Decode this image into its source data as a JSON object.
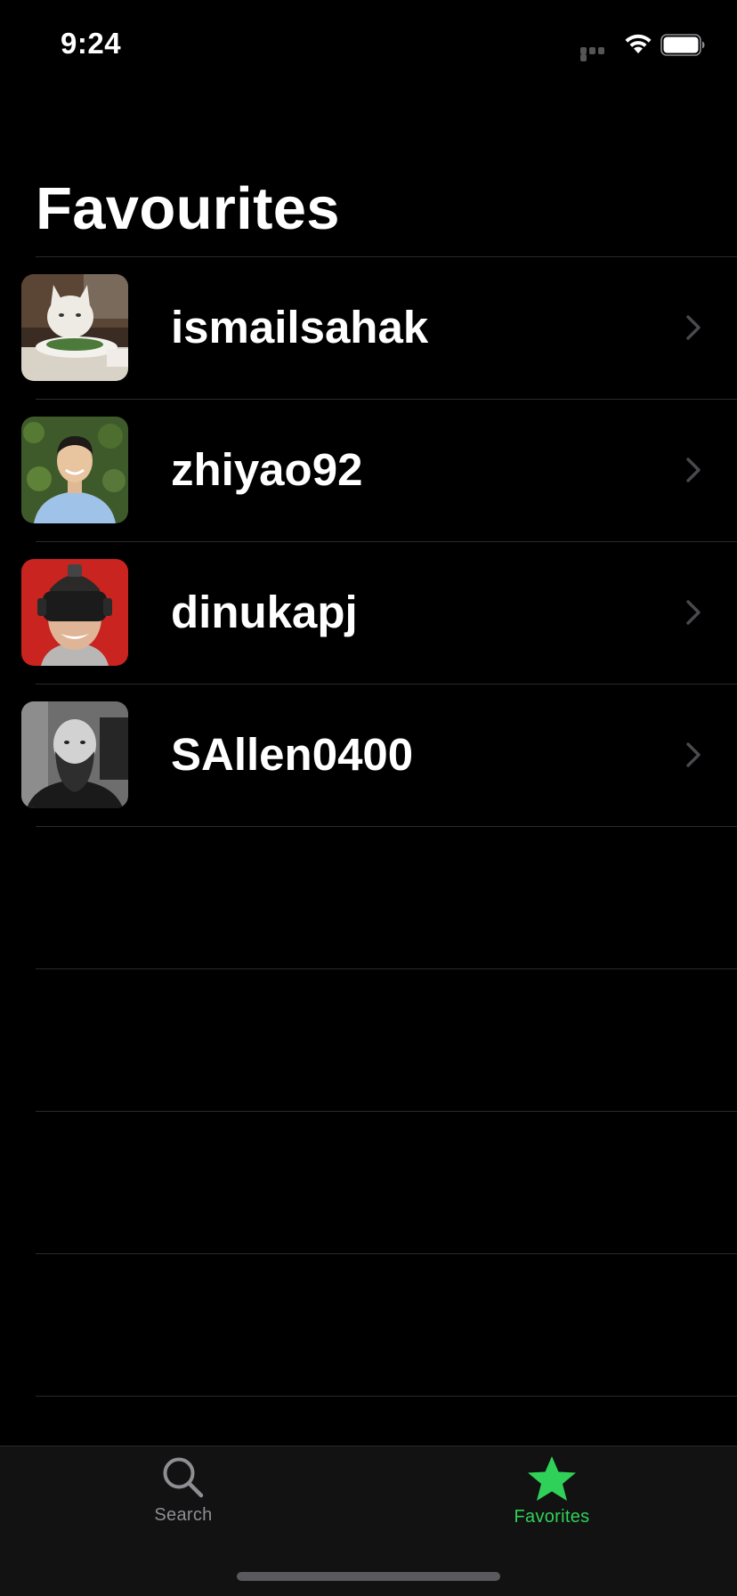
{
  "status_bar": {
    "time": "9:24"
  },
  "page": {
    "title": "Favourites"
  },
  "favorites": [
    {
      "username": "ismailsahak",
      "avatar": "cat-at-table-photo"
    },
    {
      "username": "zhiyao92",
      "avatar": "smiling-man-photo"
    },
    {
      "username": "dinukapj",
      "avatar": "vr-headset-man-photo"
    },
    {
      "username": "SAllen0400",
      "avatar": "bearded-man-bw-photo"
    }
  ],
  "tab_bar": {
    "tabs": [
      {
        "label": "Search",
        "icon": "search-icon",
        "selected": false
      },
      {
        "label": "Favorites",
        "icon": "star-icon",
        "selected": true
      }
    ],
    "accent_color": "#30d158",
    "inactive_color": "#8e8e93"
  },
  "colors": {
    "background": "#000000",
    "separator": "#2a2a2c",
    "tab_bar_background": "#121212"
  }
}
